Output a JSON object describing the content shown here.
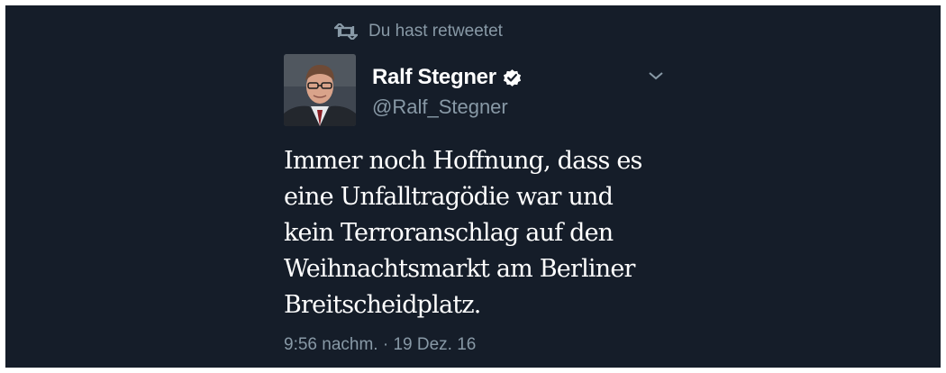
{
  "retweet": {
    "icon": "retweet-icon",
    "label": "Du hast retweetet"
  },
  "tweet": {
    "author": {
      "display_name": "Ralf Stegner",
      "handle": "@Ralf_Stegner",
      "verified": true,
      "verified_icon": "verified-badge-icon",
      "avatar": "avatar-photo"
    },
    "menu_icon": "chevron-down-icon",
    "lines": [
      "Immer noch Hoffnung, dass es",
      "eine Unfalltragödie war und",
      "kein Terroranschlag auf den",
      "Weihnachtsmarkt am Berliner",
      "Breitscheidplatz."
    ],
    "timestamp": "9:56 nachm. · 19 Dez. 16"
  },
  "colors": {
    "background": "#151d29",
    "text_primary": "#ffffff",
    "text_secondary": "#8899a6"
  }
}
